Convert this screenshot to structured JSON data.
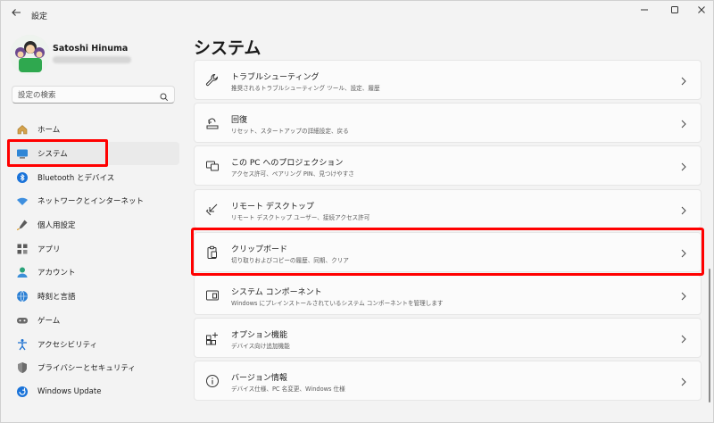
{
  "window": {
    "title": "設定",
    "back_icon": "back-arrow-icon",
    "minimize_icon": "minimize-icon",
    "maximize_icon": "maximize-icon",
    "close_icon": "close-icon"
  },
  "profile": {
    "name": "Satoshi Hinuma"
  },
  "search": {
    "placeholder": "設定の検索"
  },
  "sidebar": {
    "items": [
      {
        "label": "ホーム",
        "icon": "home-icon"
      },
      {
        "label": "システム",
        "icon": "system-icon"
      },
      {
        "label": "Bluetooth とデバイス",
        "icon": "bluetooth-icon"
      },
      {
        "label": "ネットワークとインターネット",
        "icon": "network-icon"
      },
      {
        "label": "個人用設定",
        "icon": "personalization-icon"
      },
      {
        "label": "アプリ",
        "icon": "apps-icon"
      },
      {
        "label": "アカウント",
        "icon": "account-icon"
      },
      {
        "label": "時刻と言語",
        "icon": "time-language-icon"
      },
      {
        "label": "ゲーム",
        "icon": "gaming-icon"
      },
      {
        "label": "アクセシビリティ",
        "icon": "accessibility-icon"
      },
      {
        "label": "プライバシーとセキュリティ",
        "icon": "privacy-shield-icon"
      },
      {
        "label": "Windows Update",
        "icon": "windows-update-icon"
      }
    ]
  },
  "main": {
    "title": "システム",
    "cards": [
      {
        "title": "トラブルシューティング",
        "subtitle": "推奨されるトラブルシューティング ツール、設定、履歴",
        "icon": "wrench-icon"
      },
      {
        "title": "回復",
        "subtitle": "リセット、スタートアップの詳細設定、戻る",
        "icon": "recovery-icon"
      },
      {
        "title": "この PC へのプロジェクション",
        "subtitle": "アクセス許可、ペアリング PIN、見つけやすさ",
        "icon": "projection-icon"
      },
      {
        "title": "リモート デスクトップ",
        "subtitle": "リモート デスクトップ ユーザー、接続アクセス許可",
        "icon": "remote-desktop-icon"
      },
      {
        "title": "クリップボード",
        "subtitle": "切り取りおよびコピーの履歴、同期、クリア",
        "icon": "clipboard-icon"
      },
      {
        "title": "システム コンポーネント",
        "subtitle": "Windows にプレインストールされているシステム コンポーネントを管理します",
        "icon": "system-components-icon"
      },
      {
        "title": "オプション機能",
        "subtitle": "デバイス向け追加機能",
        "icon": "optional-features-icon"
      },
      {
        "title": "バージョン情報",
        "subtitle": "デバイス仕様、PC 名変更、Windows 仕様",
        "icon": "info-icon"
      }
    ]
  },
  "colors": {
    "highlight": "#ff0000",
    "accent": "#0067c0"
  }
}
